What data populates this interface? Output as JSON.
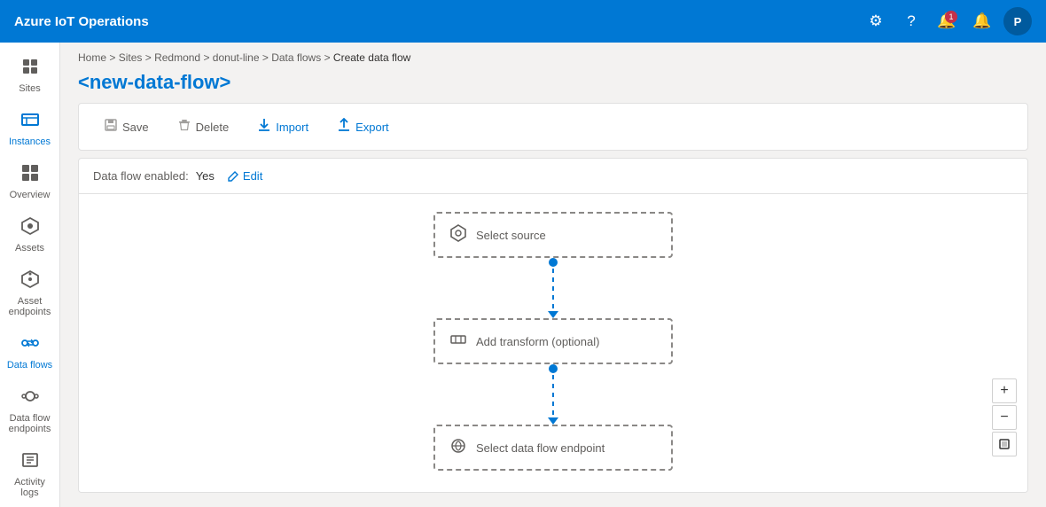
{
  "app": {
    "title": "Azure IoT Operations"
  },
  "topbar": {
    "title": "Azure IoT Operations",
    "avatar_label": "P",
    "notification_count": "1"
  },
  "sidebar": {
    "items": [
      {
        "id": "sites",
        "label": "Sites",
        "icon": "⊞",
        "active": false
      },
      {
        "id": "instances",
        "label": "Instances",
        "icon": "◫",
        "active": false
      },
      {
        "id": "overview",
        "label": "Overview",
        "icon": "▦",
        "active": false
      },
      {
        "id": "assets",
        "label": "Assets",
        "icon": "⬡",
        "active": false
      },
      {
        "id": "asset-endpoints",
        "label": "Asset endpoints",
        "icon": "⬡",
        "active": false
      },
      {
        "id": "data-flows",
        "label": "Data flows",
        "icon": "⇌",
        "active": true
      },
      {
        "id": "data-flow-endpoints",
        "label": "Data flow endpoints",
        "icon": "⬡",
        "active": false
      },
      {
        "id": "activity-logs",
        "label": "Activity logs",
        "icon": "☰",
        "active": false
      }
    ]
  },
  "breadcrumb": {
    "items": [
      "Home",
      "Sites",
      "Redmond",
      "donut-line",
      "Data flows",
      "Create data flow"
    ]
  },
  "page": {
    "title": "<new-data-flow>"
  },
  "toolbar": {
    "save_label": "Save",
    "delete_label": "Delete",
    "import_label": "Import",
    "export_label": "Export"
  },
  "dataflow_bar": {
    "label": "Data flow enabled:",
    "value": "Yes",
    "edit_label": "Edit"
  },
  "flow_nodes": [
    {
      "id": "source",
      "label": "Select source",
      "icon": "⬡"
    },
    {
      "id": "transform",
      "label": "Add transform (optional)",
      "icon": "⊞"
    },
    {
      "id": "endpoint",
      "label": "Select data flow endpoint",
      "icon": "⬡"
    }
  ],
  "zoom_controls": {
    "zoom_in_label": "+",
    "zoom_out_label": "−",
    "fit_label": "⊡"
  }
}
